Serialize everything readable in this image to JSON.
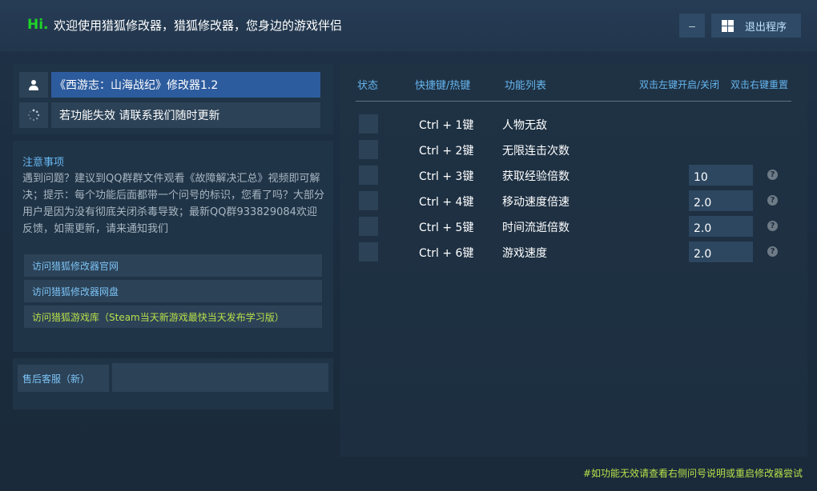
{
  "header": {
    "hi": "Hi.",
    "welcome": "欢迎使用猎狐修改器，猎狐修改器，您身边的游戏伴侣",
    "minimize_label": "–",
    "exit_label": "退出程序"
  },
  "game": {
    "title": "《西游志：山海战纪》修改器1.2",
    "info": "若功能失效  请联系我们随时更新"
  },
  "notes": {
    "title": "注意事项",
    "body": "遇到问题？建议到QQ群群文件观看《故障解决汇总》视频即可解决；提示：每个功能后面都带一个问号的标识，您看了吗？大部分用户是因为没有彻底关闭杀毒导致；最新QQ群933829084欢迎反馈，如需更新，请来通知我们"
  },
  "links": [
    {
      "label": "访问猎狐修改器官网"
    },
    {
      "label": "访问猎狐修改器网盘"
    },
    {
      "label": "访问猎狐游戏库（Steam当天新游戏最快当天发布学习版）"
    }
  ],
  "service": {
    "label": "售后客服（新）"
  },
  "table": {
    "headers": {
      "status": "状态",
      "hotkey": "快捷键/热键",
      "features": "功能列表",
      "left_click": "双击左键开启/关闭",
      "right_click": "双击右键重置"
    },
    "rows": [
      {
        "hotkey": "Ctrl + 1键",
        "name": "人物无敌"
      },
      {
        "hotkey": "Ctrl + 2键",
        "name": "无限连击次数"
      },
      {
        "hotkey": "Ctrl + 3键",
        "name": "获取经验倍数",
        "value": "10"
      },
      {
        "hotkey": "Ctrl + 4键",
        "name": "移动速度倍速",
        "value": "2.0"
      },
      {
        "hotkey": "Ctrl + 5键",
        "name": "时间流逝倍数",
        "value": "2.0"
      },
      {
        "hotkey": "Ctrl + 6键",
        "name": "游戏速度",
        "value": "2.0"
      }
    ],
    "help_glyph": "?"
  },
  "footer": {
    "note": "#如功能无效请查看右侧问号说明或重启修改器尝试"
  },
  "colors": {
    "accent_blue": "#66b6f0",
    "hi_green": "#1fd428",
    "note_green": "#b8e04a",
    "title_bar": "#2d5c9e"
  }
}
